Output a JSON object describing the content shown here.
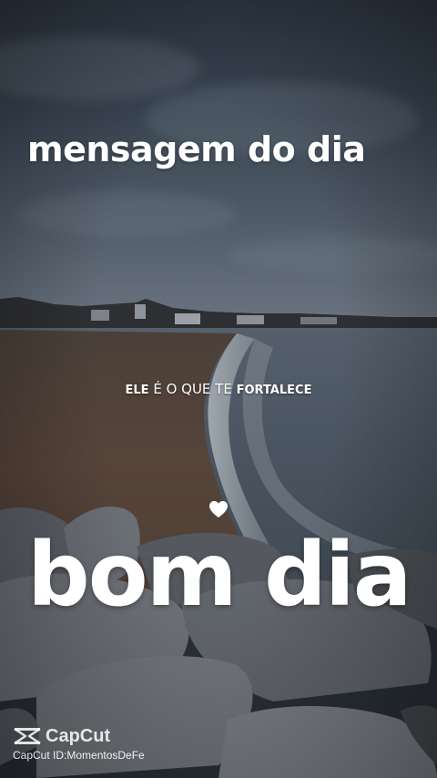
{
  "headline": "mensagem do dia",
  "phrase": {
    "part1": "ELE",
    "part2": " É O QUE TE ",
    "part3": "FORTALECE"
  },
  "heart_icon": "heart-icon",
  "greeting": "bom dia",
  "watermark": {
    "brand": "CapCut",
    "id_text": "CapCut ID:MomentosDeFe",
    "logo_icon": "capcut-logo-icon"
  },
  "colors": {
    "text": "#ffffff",
    "sky": "#3a4552",
    "sand": "#5a4436",
    "sea": "#4a5561",
    "rock": "#6a6e74"
  }
}
